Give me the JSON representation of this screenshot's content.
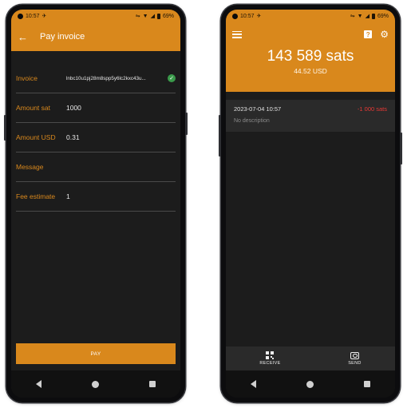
{
  "colors": {
    "accent": "#d9881c",
    "negative": "#e53935",
    "background": "#1c1c1c",
    "success": "#3a9a4a"
  },
  "status_bar": {
    "time": "10:57",
    "battery": "69%"
  },
  "left_screen": {
    "title": "Pay invoice",
    "fields": [
      {
        "label": "Invoice",
        "value": "lnbc10u1pj28m8spp5y6lc2kxc43u..."
      },
      {
        "label": "Amount sat",
        "value": "1000"
      },
      {
        "label": "Amount USD",
        "value": "0.31"
      },
      {
        "label": "Message",
        "value": ""
      },
      {
        "label": "Fee estimate",
        "value": "1"
      }
    ],
    "pay_button_label": "PAY"
  },
  "right_screen": {
    "balance_sats": "143 589 sats",
    "balance_usd": "44.52 USD",
    "transactions": [
      {
        "date": "2023-07-04 10:57",
        "amount": "-1 000 sats",
        "description": "No description"
      }
    ],
    "receive_label": "RECEIVE",
    "send_label": "SEND"
  },
  "icons": [
    "back-arrow-icon",
    "check-icon",
    "menu-icon",
    "help-icon",
    "gear-icon",
    "qr-code-icon",
    "camera-icon",
    "wifi-icon",
    "signal-icon",
    "battery-icon",
    "nav-back-icon",
    "nav-home-icon",
    "nav-recents-icon"
  ]
}
